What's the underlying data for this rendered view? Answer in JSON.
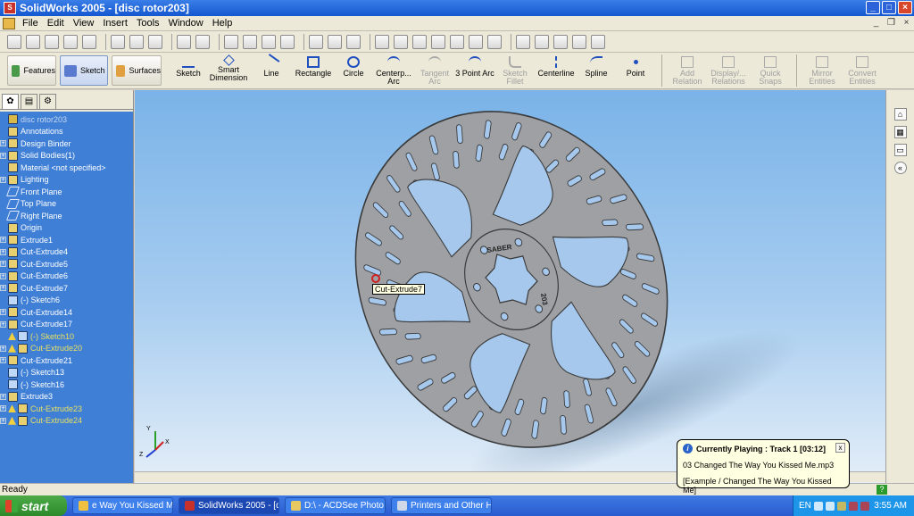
{
  "window": {
    "title": "SolidWorks 2005 - [disc rotor203]"
  },
  "menu": [
    "File",
    "Edit",
    "View",
    "Insert",
    "Tools",
    "Window",
    "Help"
  ],
  "command_manager": {
    "groups": [
      {
        "label": "Features"
      },
      {
        "label": "Sketch"
      },
      {
        "label": "Surfaces"
      }
    ],
    "tools": [
      {
        "label": "Sketch",
        "enabled": true
      },
      {
        "label": "Smart Dimension",
        "enabled": true
      },
      {
        "label": "Line",
        "enabled": true
      },
      {
        "label": "Rectangle",
        "enabled": true
      },
      {
        "label": "Circle",
        "enabled": true
      },
      {
        "label": "Centerp... Arc",
        "enabled": true
      },
      {
        "label": "Tangent Arc",
        "enabled": false
      },
      {
        "label": "3 Point Arc",
        "enabled": true
      },
      {
        "label": "Sketch Fillet",
        "enabled": false
      },
      {
        "label": "Centerline",
        "enabled": true
      },
      {
        "label": "Spline",
        "enabled": true
      },
      {
        "label": "Point",
        "enabled": true
      },
      {
        "label": "Add Relation",
        "enabled": false
      },
      {
        "label": "Display/... Relations",
        "enabled": false
      },
      {
        "label": "Quick Snaps",
        "enabled": false
      },
      {
        "label": "Mirror Entities",
        "enabled": false
      },
      {
        "label": "Convert Entities",
        "enabled": false
      }
    ]
  },
  "tree": {
    "root": "disc rotor203",
    "items": [
      {
        "label": "Annotations",
        "icon": "annotations-icon",
        "expandable": false,
        "warning": false
      },
      {
        "label": "Design Binder",
        "icon": "binder-icon",
        "expandable": true,
        "warning": false
      },
      {
        "label": "Solid Bodies(1)",
        "icon": "solid-bodies-icon",
        "expandable": true,
        "warning": false
      },
      {
        "label": "Material <not specified>",
        "icon": "material-icon",
        "expandable": false,
        "warning": false
      },
      {
        "label": "Lighting",
        "icon": "lighting-icon",
        "expandable": true,
        "warning": false
      },
      {
        "label": "Front Plane",
        "icon": "plane-icon",
        "expandable": false,
        "warning": false
      },
      {
        "label": "Top Plane",
        "icon": "plane-icon",
        "expandable": false,
        "warning": false
      },
      {
        "label": "Right Plane",
        "icon": "plane-icon",
        "expandable": false,
        "warning": false
      },
      {
        "label": "Origin",
        "icon": "origin-icon",
        "expandable": false,
        "warning": false
      },
      {
        "label": "Extrude1",
        "icon": "feature-icon",
        "expandable": true,
        "warning": false
      },
      {
        "label": "Cut-Extrude4",
        "icon": "feature-icon",
        "expandable": true,
        "warning": false
      },
      {
        "label": "Cut-Extrude5",
        "icon": "feature-icon",
        "expandable": true,
        "warning": false
      },
      {
        "label": "Cut-Extrude6",
        "icon": "feature-icon",
        "expandable": true,
        "warning": false
      },
      {
        "label": "Cut-Extrude7",
        "icon": "feature-icon",
        "expandable": true,
        "warning": false
      },
      {
        "label": "(-) Sketch6",
        "icon": "sketch-icon",
        "expandable": false,
        "warning": false
      },
      {
        "label": "Cut-Extrude14",
        "icon": "feature-icon",
        "expandable": true,
        "warning": false
      },
      {
        "label": "Cut-Extrude17",
        "icon": "feature-icon",
        "expandable": true,
        "warning": false
      },
      {
        "label": "(-) Sketch10",
        "icon": "sketch-icon",
        "expandable": false,
        "warning": true
      },
      {
        "label": "Cut-Extrude20",
        "icon": "feature-icon",
        "expandable": true,
        "warning": true
      },
      {
        "label": "Cut-Extrude21",
        "icon": "feature-icon",
        "expandable": true,
        "warning": false
      },
      {
        "label": "(-) Sketch13",
        "icon": "sketch-icon",
        "expandable": false,
        "warning": false
      },
      {
        "label": "(-) Sketch16",
        "icon": "sketch-icon",
        "expandable": false,
        "warning": false
      },
      {
        "label": "Extrude3",
        "icon": "feature-icon",
        "expandable": true,
        "warning": false
      },
      {
        "label": "Cut-Extrude23",
        "icon": "feature-icon",
        "expandable": true,
        "warning": true
      },
      {
        "label": "Cut-Extrude24",
        "icon": "feature-icon",
        "expandable": true,
        "warning": true
      }
    ]
  },
  "viewport": {
    "tooltip": "Cut-Extrude7",
    "rotor_text_top": "SABER",
    "rotor_text_side": "203",
    "triad": {
      "x": "X",
      "y": "Y",
      "z": "Z"
    }
  },
  "status": {
    "text": "Ready"
  },
  "notification": {
    "title": "Currently Playing : Track 1 [03:12]",
    "line1": "03 Changed The Way You Kissed Me.mp3",
    "line2": "[Example / Changed The Way You Kissed Me]",
    "close": "x"
  },
  "taskbar": {
    "start": "start",
    "tasks": [
      {
        "label": "e Way You Kissed Me...",
        "active": false
      },
      {
        "label": "SolidWorks 2005 - [di...",
        "active": true
      },
      {
        "label": "D:\\ - ACDSee Photo ...",
        "active": false
      },
      {
        "label": "Printers and Other H...",
        "active": false
      }
    ],
    "lang": "EN",
    "clock": "3:55 AM"
  },
  "colors": {
    "tree_bg": "#3f7fd6",
    "viewport_top": "#7ab3e8",
    "viewport_bottom": "#e4eef8",
    "warning_text": "#e8e060",
    "rotor_fill": "#9ea0a4"
  }
}
